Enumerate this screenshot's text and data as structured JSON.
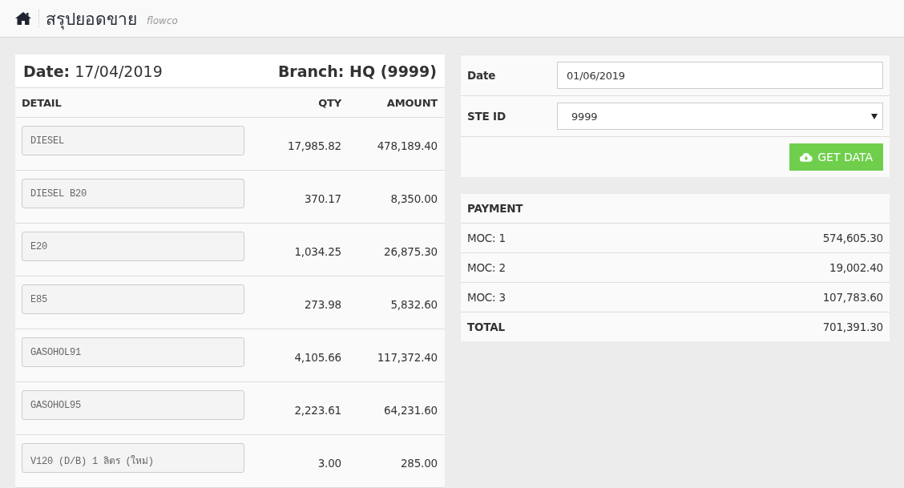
{
  "header": {
    "title": "สรุปยอดขาย",
    "subtitle": "flowco"
  },
  "summary": {
    "date": "**Date:** 17/04/2019",
    "branch": "Branch: HQ (9999)",
    "columns": [
      "DETAIL",
      "QTY",
      "AMOUNT"
    ],
    "rows": [
      {
        "detail": "DIESEL",
        "qty": "17,985.82",
        "amount": "478,189.40"
      },
      {
        "detail": "DIESEL B20",
        "qty": "370.17",
        "amount": "8,350.00"
      },
      {
        "detail": "E20",
        "qty": "1,034.25",
        "amount": "26,875.30"
      },
      {
        "detail": "E85",
        "qty": "273.98",
        "amount": "5,832.60"
      },
      {
        "detail": "GASOHOL91",
        "qty": "4,105.66",
        "amount": "117,372.40"
      },
      {
        "detail": "GASOHOL95",
        "qty": "2,223.61",
        "amount": "64,231.60"
      },
      {
        "detail": "V120 (D/B) 1 ลิตร (ใหม่)",
        "qty": "3.00",
        "amount": "285.00"
      }
    ]
  },
  "form": {
    "date_label": "Date",
    "date_value": "01/06/2019",
    "ste_label": "STE ID",
    "ste_value": "9999",
    "button": "GET DATA"
  },
  "payment": {
    "heading": "PAYMENT",
    "rows": [
      {
        "kind": "item",
        "label": "MOC: 1",
        "value": "574,605.30"
      },
      {
        "kind": "item",
        "label": "MOC: 2",
        "value": "19,002.40"
      },
      {
        "kind": "item",
        "label": "MOC: 3",
        "value": "107,783.60"
      },
      {
        "kind": "total",
        "label": "TOTAL",
        "value": "701,391.30"
      }
    ]
  }
}
